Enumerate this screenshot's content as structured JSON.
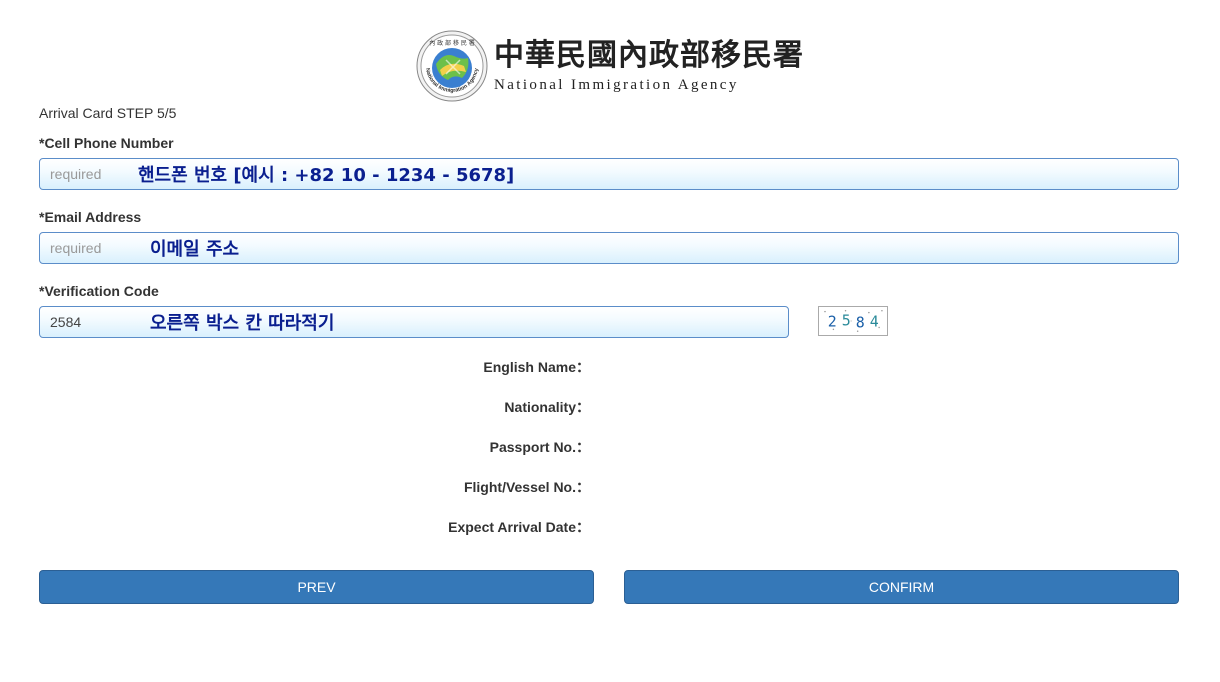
{
  "header": {
    "agency_zh": "中華民國內政部移民署",
    "agency_en": "National Immigration Agency",
    "emblem_top_text": "內 政 部 移 民 署",
    "emblem_ring_text": "National Immigration Agency"
  },
  "step_title": "Arrival Card STEP 5/5",
  "fields": {
    "phone": {
      "label": "*Cell Phone Number",
      "placeholder": "required",
      "hint": "핸드폰 번호   [예시 : +82 10 - 1234 - 5678]"
    },
    "email": {
      "label": "*Email Address",
      "placeholder": "required",
      "hint": "이메일 주소"
    },
    "verification": {
      "label": "*Verification Code",
      "value": "2584",
      "hint": "오른쪽 박스 칸 따라적기"
    }
  },
  "captcha": {
    "digits": [
      "2",
      "5",
      "8",
      "4"
    ]
  },
  "info_rows": [
    "English Name：",
    "Nationality：",
    "Passport No.：",
    "Flight/Vessel No.：",
    "Expect Arrival Date："
  ],
  "buttons": {
    "prev": "PREV",
    "confirm": "CONFIRM"
  },
  "colors": {
    "button": "#3578b8",
    "input_border": "#5b8dc9",
    "hint_text": "#0a1f8f"
  }
}
